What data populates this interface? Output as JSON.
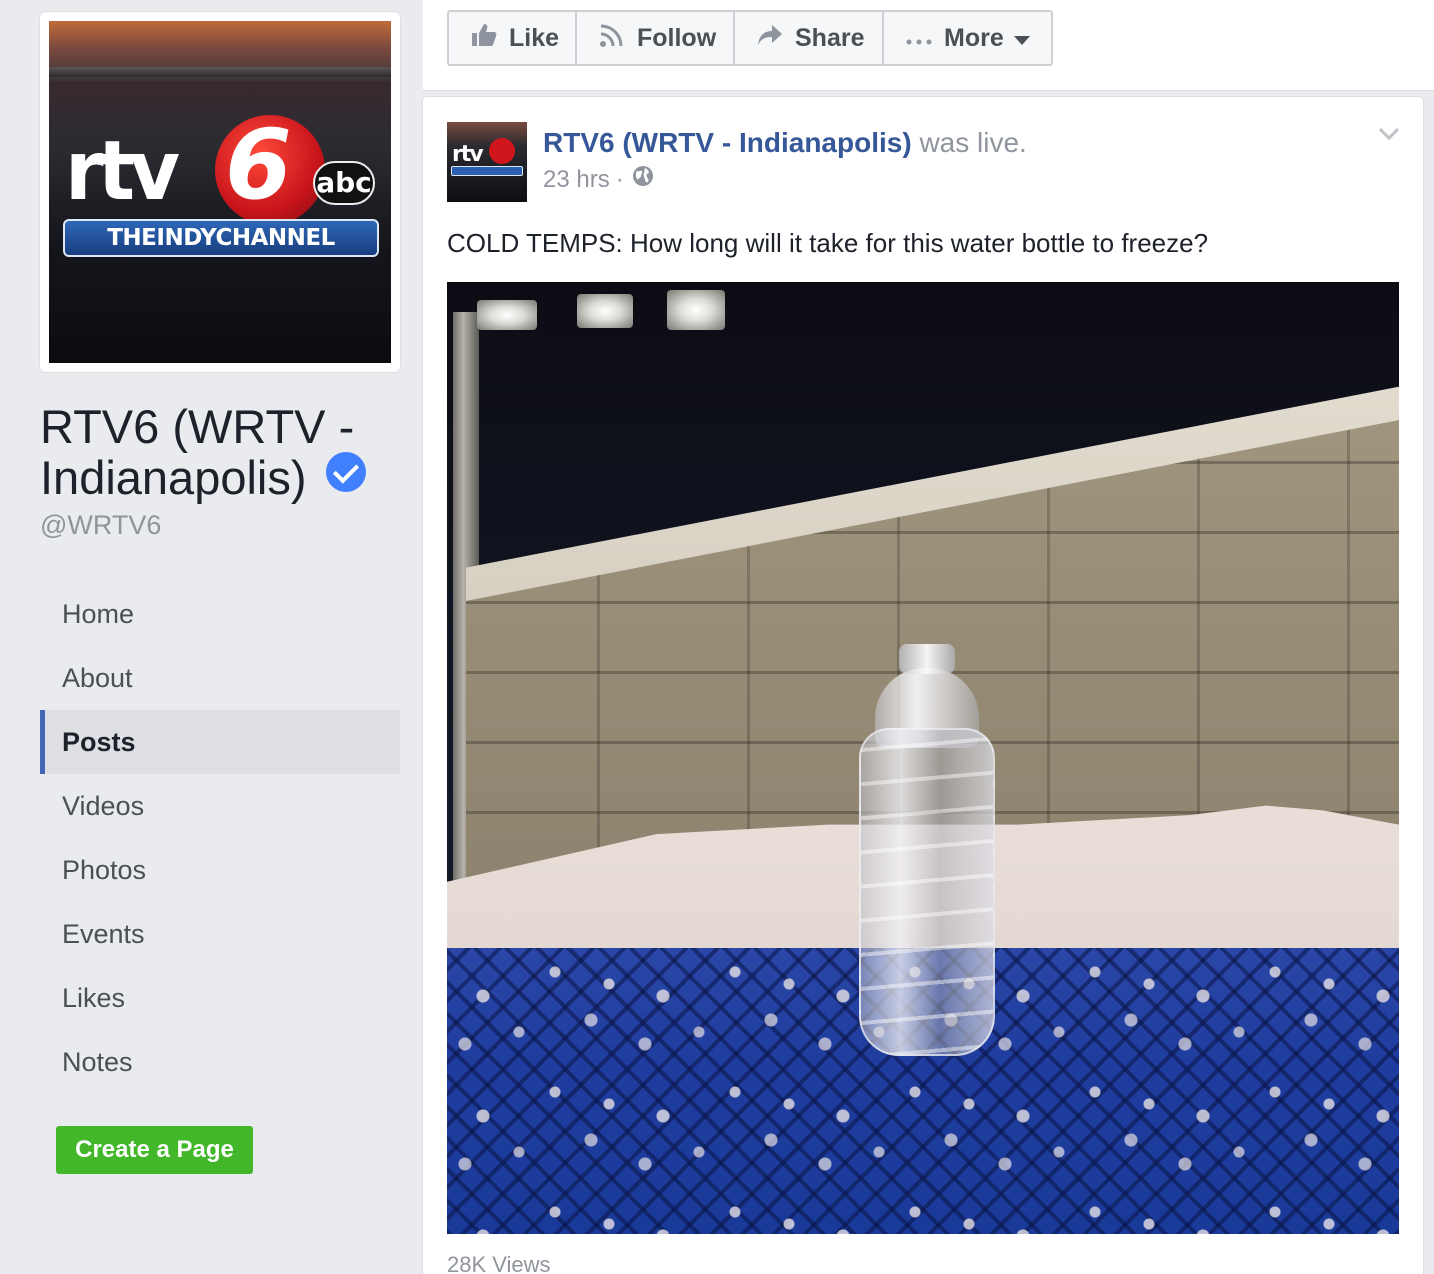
{
  "page": {
    "name": "RTV6 (WRTV - Indianapolis)",
    "handle": "@WRTV6",
    "profile_logo": {
      "wordmark": "rtv",
      "number": "6",
      "network": "abc",
      "band": "THEINDYCHANNEL"
    }
  },
  "sidebar": {
    "items": [
      {
        "label": "Home",
        "active": false
      },
      {
        "label": "About",
        "active": false
      },
      {
        "label": "Posts",
        "active": true
      },
      {
        "label": "Videos",
        "active": false
      },
      {
        "label": "Photos",
        "active": false
      },
      {
        "label": "Events",
        "active": false
      },
      {
        "label": "Likes",
        "active": false
      },
      {
        "label": "Notes",
        "active": false
      }
    ],
    "create_page_label": "Create a Page"
  },
  "actions": {
    "like": {
      "label": "Like",
      "icon": "thumbs-up-icon"
    },
    "follow": {
      "label": "Follow",
      "icon": "rss-icon"
    },
    "share": {
      "label": "Share",
      "icon": "share-arrow-icon"
    },
    "more": {
      "label": "More",
      "icon": "ellipsis-icon"
    }
  },
  "post": {
    "author": "RTV6 (WRTV - Indianapolis)",
    "action": "was live.",
    "time": "23 hrs",
    "separator": "·",
    "privacy_icon": "globe-icon",
    "text": "COLD TEMPS: How long will it take for this water bottle to freeze?",
    "views": "28K Views"
  },
  "colors": {
    "link": "#365899",
    "active_nav_border": "#4267b2",
    "create_button": "#42b72a",
    "verified": "#4080ff",
    "background": "#e9ebee"
  }
}
